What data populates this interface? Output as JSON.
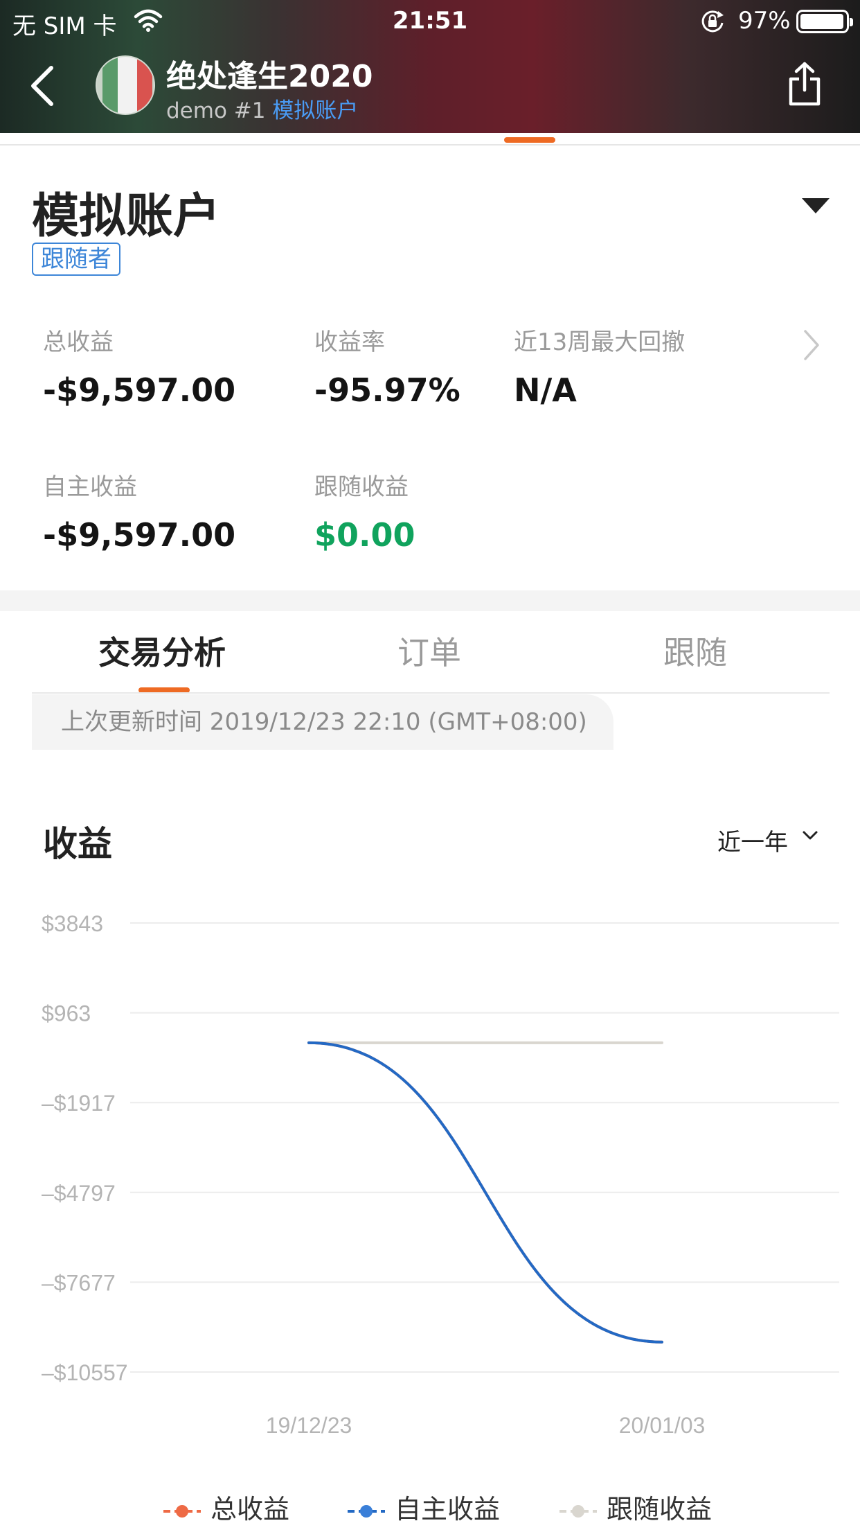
{
  "status_bar": {
    "carrier": "无 SIM 卡",
    "time": "21:51",
    "battery": "97%",
    "battery_level": 0.97
  },
  "header": {
    "title": "绝处逢生2020",
    "subtitle_prefix": "demo  #1 ",
    "subtitle_account": "模拟账户",
    "colors": {
      "account_link": "#4a9cf5"
    }
  },
  "account": {
    "title": "模拟账户",
    "role_tag": "跟随者",
    "metrics": {
      "total_profit": {
        "label": "总收益",
        "value": "-$9,597.00"
      },
      "return_rate": {
        "label": "收益率",
        "value": "-95.97%"
      },
      "max_drawdown": {
        "label": "近13周最大回撤",
        "value": "N/A"
      },
      "own_profit": {
        "label": "自主收益",
        "value": "-$9,597.00"
      },
      "follow_profit": {
        "label": "跟随收益",
        "value": "$0.00"
      }
    },
    "colors": {
      "accent": "#ee6a23",
      "positive": "#10a35d",
      "tag": "#3d86d8"
    }
  },
  "tabs": [
    {
      "label": "交易分析",
      "active": true
    },
    {
      "label": "订单",
      "active": false
    },
    {
      "label": "跟随",
      "active": false
    }
  ],
  "update_banner": "上次更新时间 2019/12/23 22:10 (GMT+08:00)",
  "chart_section": {
    "title": "收益",
    "range": "近一年"
  },
  "chart_data": {
    "type": "line",
    "title": "收益",
    "x": [
      "19/12/23",
      "20/01/03"
    ],
    "y_ticks": [
      "$3843",
      "$963",
      "–$1917",
      "–$4797",
      "–$7677",
      "–$10557"
    ],
    "y_tick_values": [
      3843,
      963,
      -1917,
      -4797,
      -7677,
      -10557
    ],
    "ylim": [
      -10557,
      3843
    ],
    "series": [
      {
        "name": "总收益",
        "color": "#ee6a45",
        "values": [
          0,
          -9597
        ]
      },
      {
        "name": "自主收益",
        "color": "#2369c4",
        "values": [
          0,
          -9597
        ]
      },
      {
        "name": "跟随收益",
        "color": "#d9d6cf",
        "values": [
          0,
          0
        ]
      }
    ],
    "grid": true,
    "legend_position": "bottom"
  }
}
